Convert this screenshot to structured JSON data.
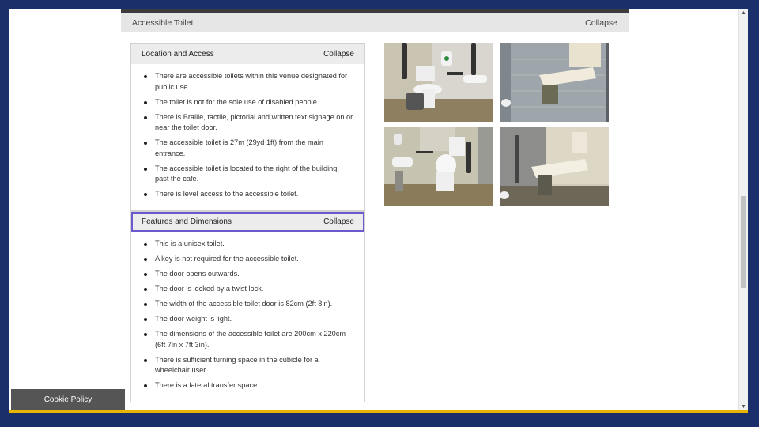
{
  "panel": {
    "title": "Accessible Toilet",
    "collapse_label": "Collapse"
  },
  "sections": [
    {
      "title": "Location and Access",
      "collapse_label": "Collapse",
      "items": [
        "There are accessible toilets within this venue designated for public use.",
        "The toilet is not for the sole use of disabled people.",
        "There is Braille, tactile, pictorial and written text signage on or near the toilet door.",
        "The accessible toilet is 27m (29yd 1ft) from the main entrance.",
        "The accessible toilet is located to the right of the building, past the cafe.",
        "There is level access to the accessible toilet."
      ]
    },
    {
      "title": "Features and Dimensions",
      "collapse_label": "Collapse",
      "items": [
        "This is a unisex toilet.",
        "A key is not required for the accessible toilet.",
        "The door opens outwards.",
        "The door is locked by a twist lock.",
        "The width of the accessible toilet door is 82cm (2ft 8in).",
        "The door weight is light.",
        "The dimensions of the accessible toilet are 200cm x 220cm (6ft 7in x 7ft 3in).",
        "There is sufficient turning space in the cubicle for a wheelchair user.",
        "There is a lateral transfer space."
      ]
    }
  ],
  "photos": [
    "toilet-photo-1",
    "baby-changing-photo-1",
    "toilet-photo-2",
    "baby-changing-photo-2"
  ],
  "cookie": {
    "label": "Cookie Policy"
  },
  "colors": {
    "frame": "#1b2f6b",
    "accent": "#e8b400",
    "focus": "#6a5acd"
  }
}
